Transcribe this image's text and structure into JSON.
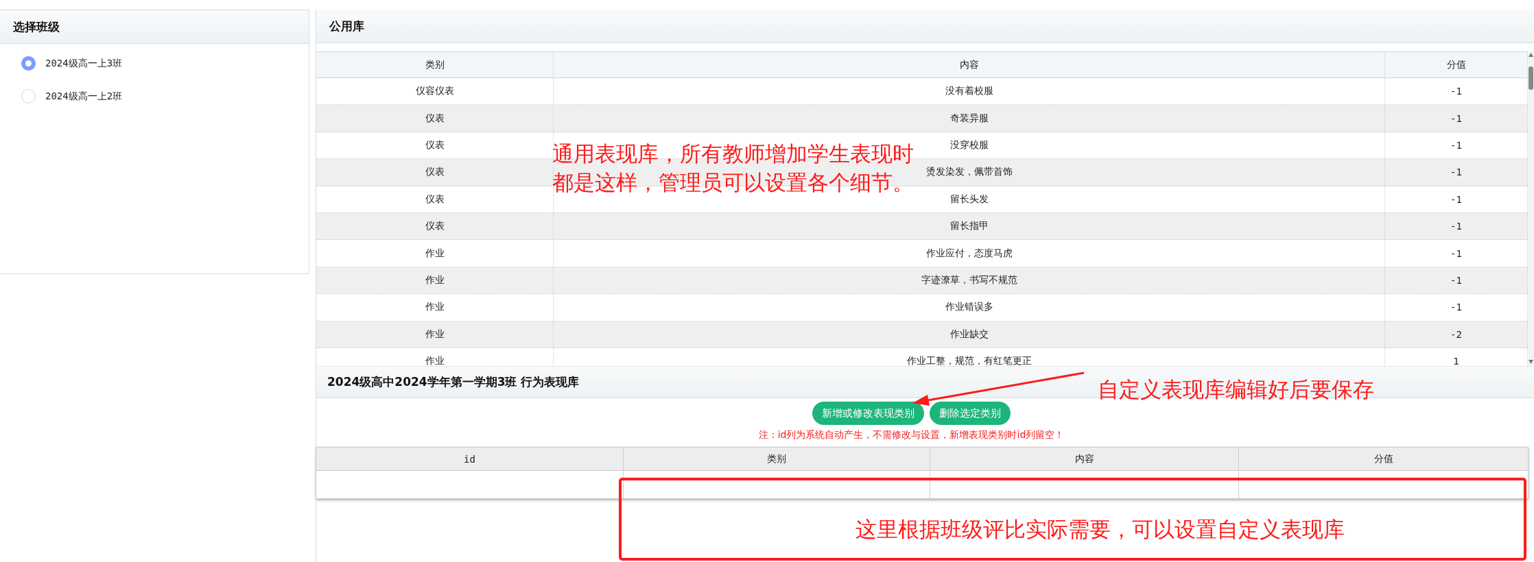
{
  "class_panel": {
    "title": "选择班级",
    "options": [
      {
        "label": "2024级高一上3班",
        "selected": true
      },
      {
        "label": "2024级高一上2班",
        "selected": false
      }
    ]
  },
  "public_library": {
    "title": "公用库",
    "columns": [
      "类别",
      "内容",
      "分值"
    ],
    "rows": [
      [
        "仪容仪表",
        "没有着校服",
        "-1"
      ],
      [
        "仪表",
        "奇装异服",
        "-1"
      ],
      [
        "仪表",
        "没穿校服",
        "-1"
      ],
      [
        "仪表",
        "烫发染发，佩带首饰",
        "-1"
      ],
      [
        "仪表",
        "留长头发",
        "-1"
      ],
      [
        "仪表",
        "留长指甲",
        "-1"
      ],
      [
        "作业",
        "作业应付，态度马虎",
        "-1"
      ],
      [
        "作业",
        "字迹潦草，书写不规范",
        "-1"
      ],
      [
        "作业",
        "作业错误多",
        "-1"
      ],
      [
        "作业",
        "作业缺交",
        "-2"
      ],
      [
        "作业",
        "作业工整，规范，有红笔更正",
        "1"
      ]
    ]
  },
  "class_library": {
    "title": "2024级高中2024学年第一学期3班 行为表现库",
    "buttons": [
      "新增或修改表现类别",
      "删除选定类别"
    ],
    "note": "注：id列为系统自动产生，不需修改与设置，新增表现类别时id列留空！",
    "columns": [
      "id",
      "类别",
      "内容",
      "分值"
    ]
  },
  "annotations": {
    "public_note": [
      "通用表现库，所有教师增加学生表现时",
      "都是这样，管理员可以设置各个细节。"
    ],
    "save_note": "自定义表现库编辑好后要保存",
    "custom_note": "这里根据班级评比实际需要，可以设置自定义表现库"
  }
}
